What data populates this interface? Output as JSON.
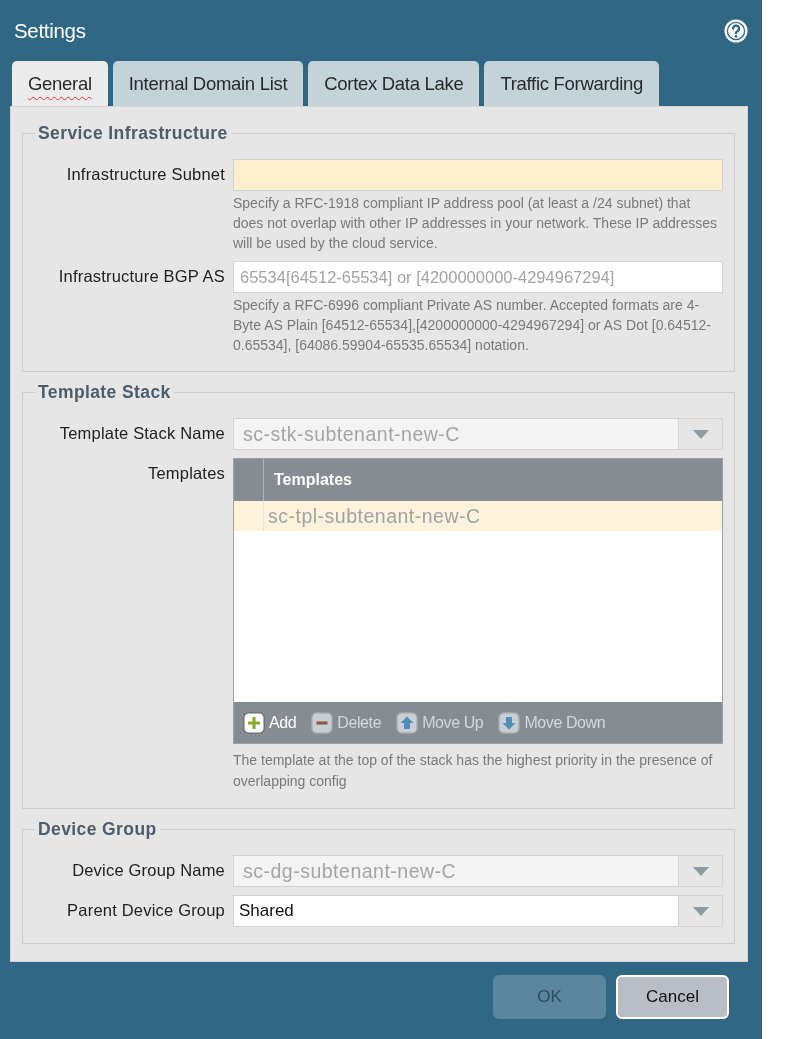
{
  "window": {
    "title": "Settings"
  },
  "tabs": [
    {
      "label": "General",
      "selected": true,
      "misspelled": true
    },
    {
      "label": "Internal Domain List",
      "selected": false,
      "misspelled": false
    },
    {
      "label": "Cortex Data Lake",
      "selected": false,
      "misspelled": false
    },
    {
      "label": "Traffic Forwarding",
      "selected": false,
      "misspelled": false
    }
  ],
  "sections": [
    {
      "title": "Service Infrastructure",
      "fields": [
        {
          "kind": "text",
          "label": "Infrastructure Subnet",
          "required": true,
          "help": "Specify a RFC-1918 compliant IP address pool (at least a /24 subnet) that does not overlap with other IP addresses in your network. These IP addresses will be used by the cloud service."
        },
        {
          "kind": "text",
          "label": "Infrastructure BGP AS",
          "required": false,
          "placeholder": "65534[64512-65534] or [4200000000-4294967294]",
          "help": "Specify a RFC-6996 compliant Private AS number. Accepted formats are 4-Byte AS Plain [64512-65534],[4200000000-4294967294] or AS Dot [0.64512-0.65534], [64086.59904-65535.65534] notation."
        }
      ]
    },
    {
      "title": "Template Stack",
      "fields": [
        {
          "kind": "dropdown",
          "label": "Template Stack Name",
          "value": "sc-stk-subtenant-new-C",
          "disabled": true
        },
        {
          "kind": "table",
          "label": "Templates",
          "columns": [
            "Templates"
          ],
          "rows": [
            {
              "cells": [
                "sc-tpl-subtenant-new-C"
              ],
              "selected": true
            }
          ],
          "actions": [
            {
              "kind": "add",
              "label": "Add",
              "disabled": false
            },
            {
              "kind": "delete",
              "label": "Delete",
              "disabled": true
            },
            {
              "kind": "move_up",
              "label": "Move Up",
              "disabled": true
            },
            {
              "kind": "move_down",
              "label": "Move Down",
              "disabled": true
            }
          ],
          "help": "The template at the top of the stack has the highest priority in the presence of overlapping config"
        }
      ]
    },
    {
      "title": "Device Group",
      "fields": [
        {
          "kind": "dropdown",
          "label": "Device Group Name",
          "value": "sc-dg-subtenant-new-C",
          "disabled": true
        },
        {
          "kind": "dropdown",
          "label": "Parent Device Group",
          "value": "Shared",
          "disabled": false
        }
      ]
    }
  ],
  "buttons": [
    {
      "label": "OK",
      "disabled": true
    },
    {
      "label": "Cancel",
      "disabled": false
    }
  ]
}
